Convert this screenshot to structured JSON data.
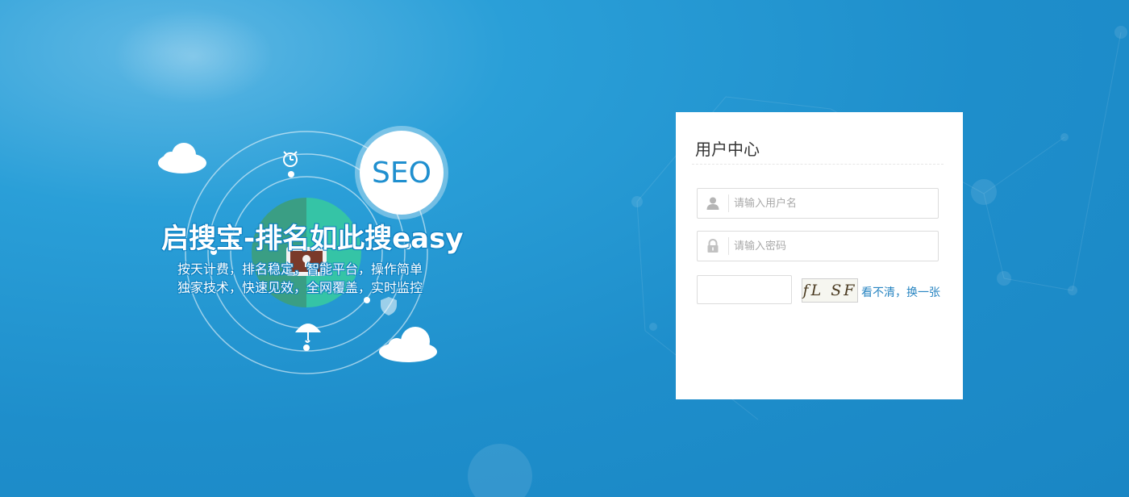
{
  "hero": {
    "badge": "SEO",
    "title": "启搜宝-排名如此搜easy",
    "line1": "按天计费，排名稳定，智能平台，操作简单",
    "line2": "独家技术，快速见效，全网覆盖，实时监控"
  },
  "login": {
    "title": "用户中心",
    "username_placeholder": "请输入用户名",
    "password_placeholder": "请输入密码",
    "captcha_text": "fL SF",
    "refresh_label": "看不清，换一张"
  },
  "icons": {
    "user": "user-icon",
    "lock": "lock-icon",
    "cloud": "cloud-icon",
    "alarm": "alarm-clock-icon",
    "umbrella": "umbrella-icon",
    "shield": "shield-icon"
  }
}
